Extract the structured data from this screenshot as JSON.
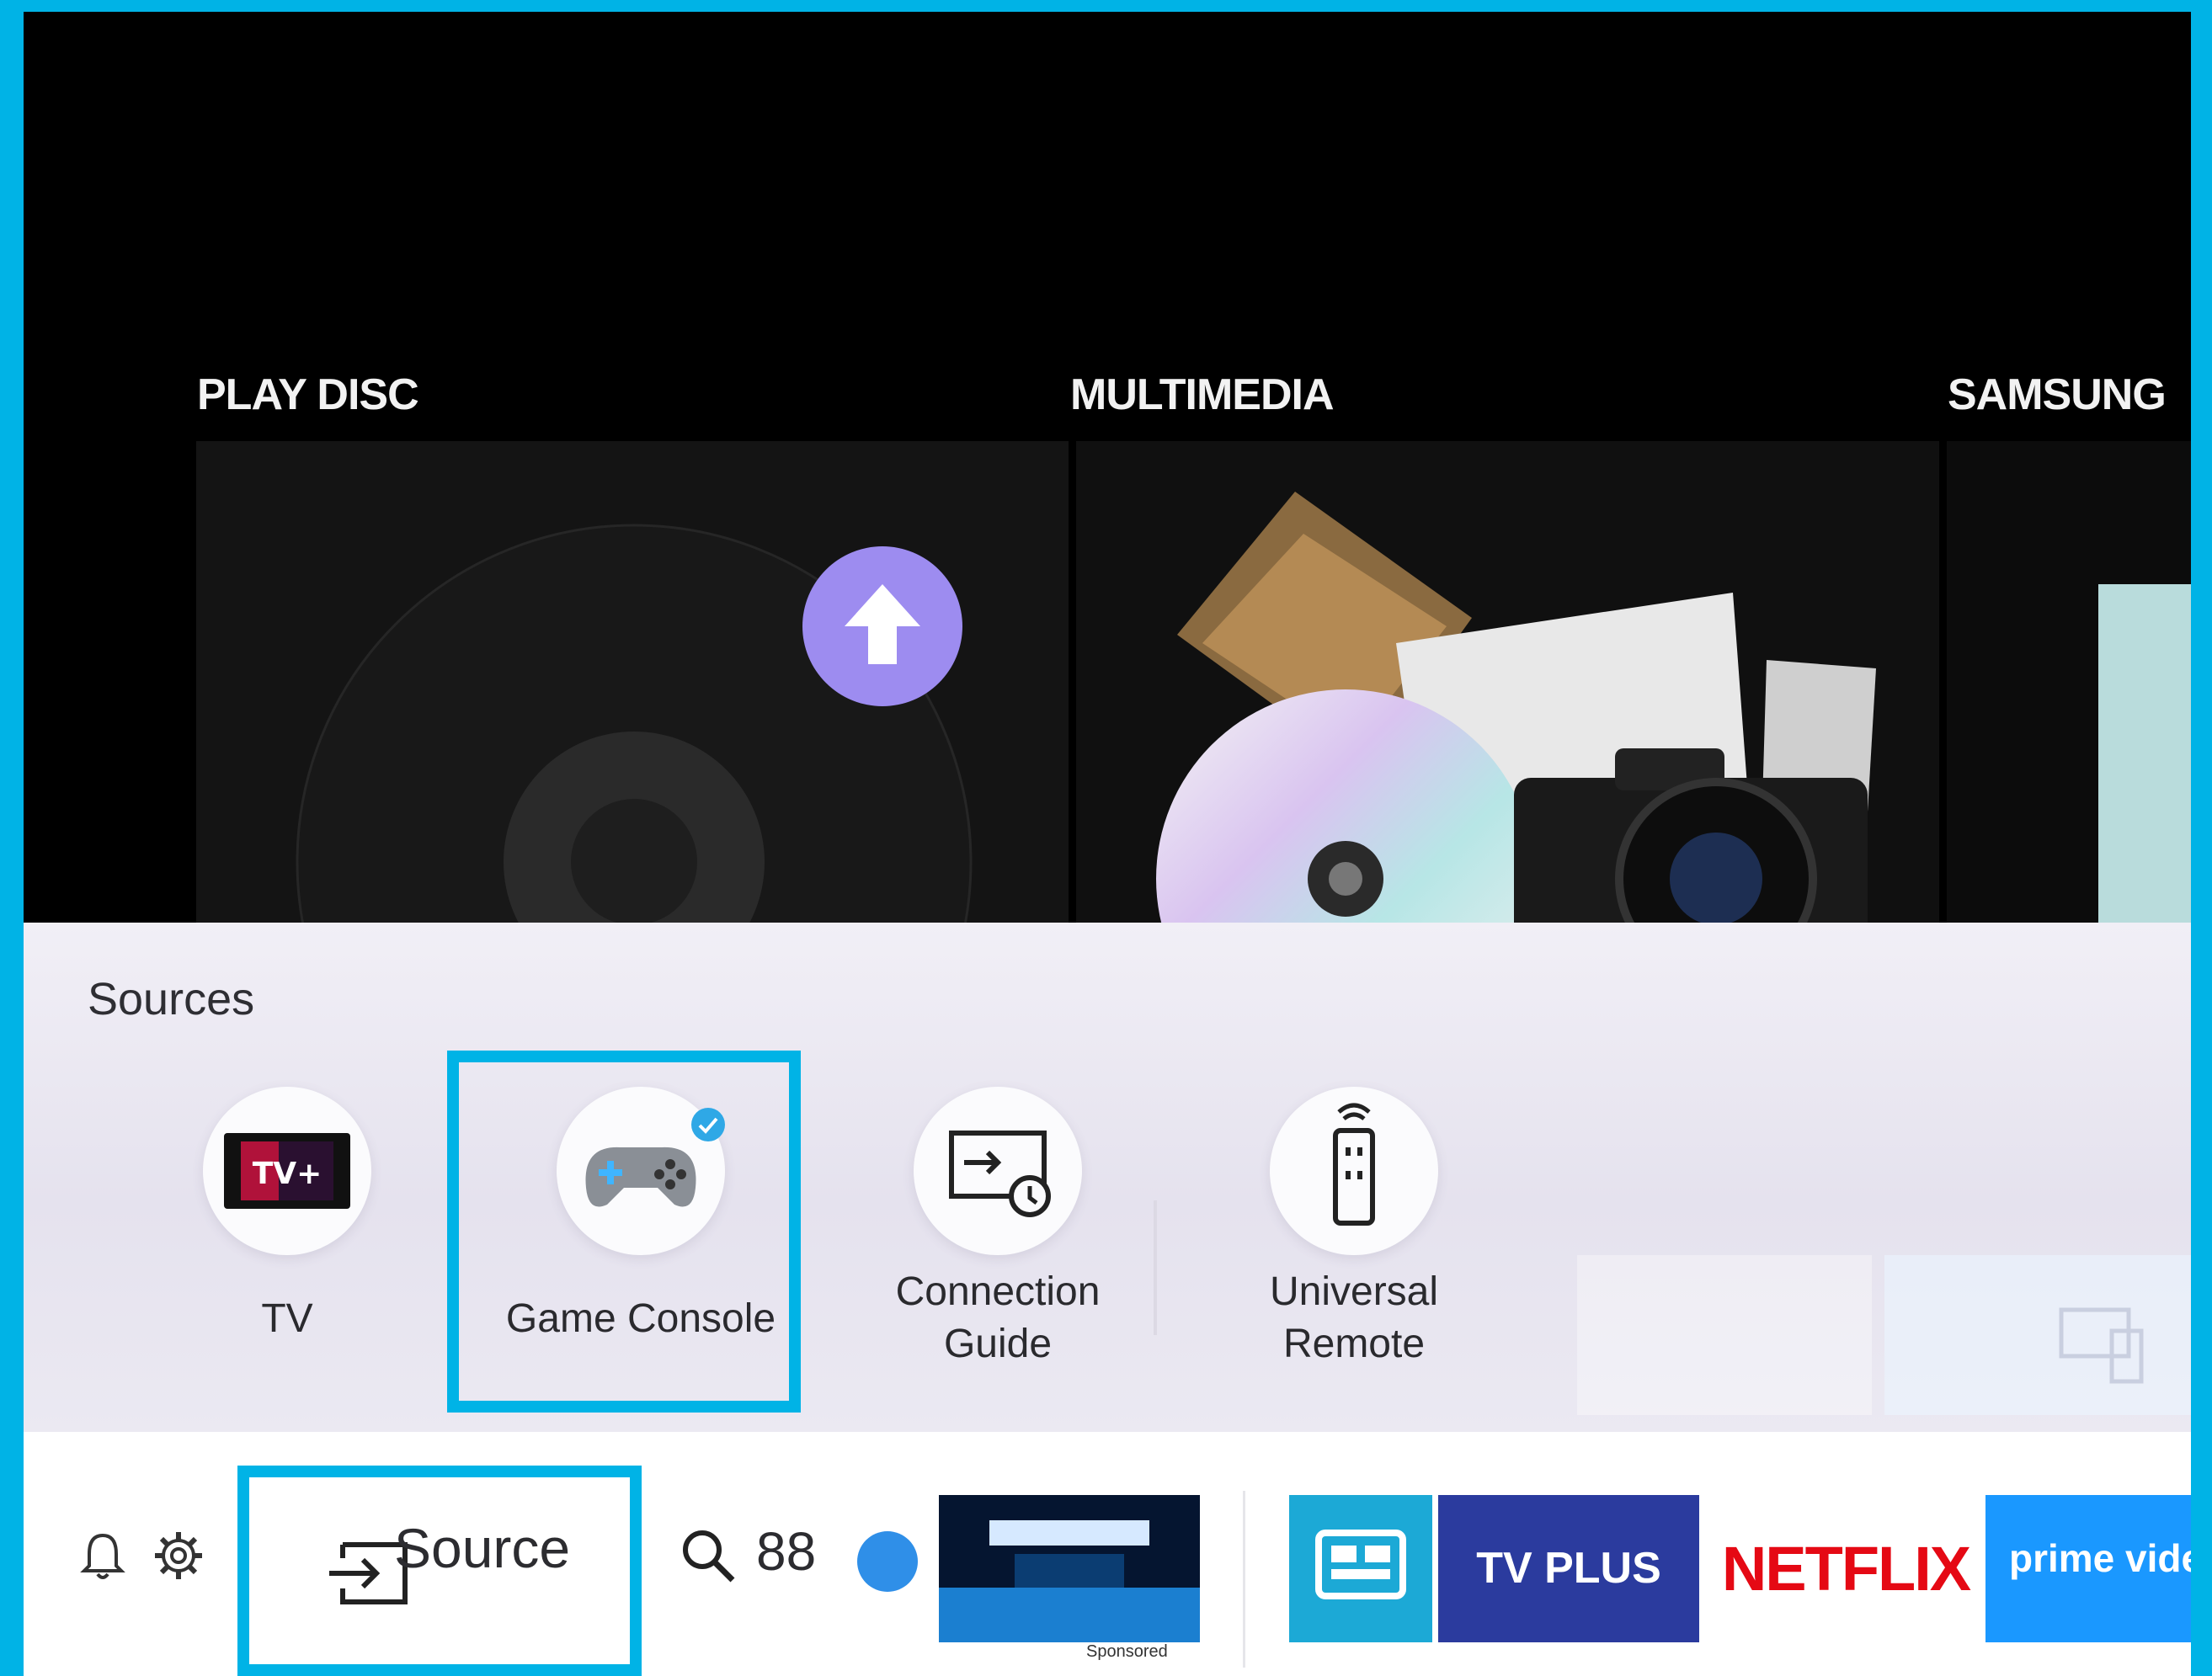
{
  "columns": {
    "play_disc": "PLAY DISC",
    "multimedia": "MULTIMEDIA",
    "samsung": "SAMSUNG"
  },
  "sources": {
    "title": "Sources",
    "items": [
      {
        "label": "TV",
        "icon": "tv-plus-icon"
      },
      {
        "label": "Game Console",
        "icon": "gamepad-icon",
        "selected": true
      },
      {
        "label_lines": [
          "Connection",
          "Guide"
        ],
        "icon": "connection-guide-icon"
      },
      {
        "label_lines": [
          "Universal",
          "Remote"
        ],
        "icon": "remote-icon"
      }
    ]
  },
  "bottom_bar": {
    "source_label": "Source",
    "apps_grid_glyph": "88",
    "sponsored_label": "Sponsored",
    "apps": [
      {
        "name": "Samsung TV Plus guide",
        "icon": "tv-guide-icon",
        "color": "#1ca9d6"
      },
      {
        "name": "Samsung TV Plus",
        "logo_text": "TV PLUS",
        "color": "#2b3b9e"
      },
      {
        "name": "Netflix",
        "logo_text": "NETFLIX",
        "color": "#e50914"
      },
      {
        "name": "Prime Video",
        "logo_text": "prime video",
        "color": "#1a98ff"
      }
    ]
  },
  "colors": {
    "highlight": "#00b3e6",
    "upload_button": "#9d8cf0"
  }
}
